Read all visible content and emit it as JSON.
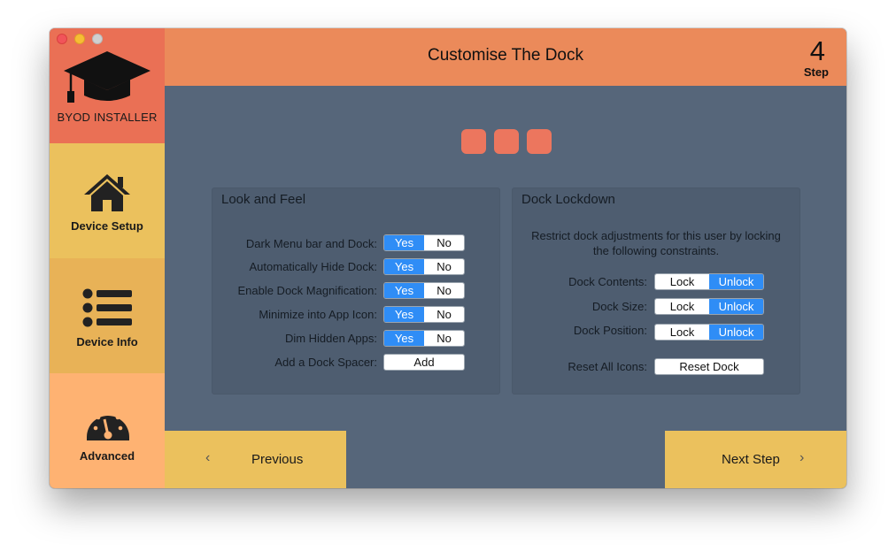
{
  "app": {
    "name": "BYOD INSTALLER"
  },
  "colors": {
    "logo_bg": "#ea7055",
    "header_bg": "#eb8a5a",
    "content_bg": "#56667a",
    "accent_blue": "#2f8df6",
    "nav_yellow": "#ebc15d"
  },
  "sidebar": {
    "items": [
      {
        "label": "Device Setup",
        "icon": "house-icon"
      },
      {
        "label": "Device Info",
        "icon": "list-icon"
      },
      {
        "label": "Advanced",
        "icon": "gauge-icon"
      }
    ]
  },
  "header": {
    "title": "Customise The Dock",
    "step_number": "4",
    "step_label": "Step"
  },
  "progress": {
    "dots": 3
  },
  "look_and_feel": {
    "title": "Look and Feel",
    "rows": [
      {
        "label": "Dark Menu bar and Dock:",
        "yes": "Yes",
        "no": "No",
        "selected": "Yes"
      },
      {
        "label": "Automatically Hide Dock:",
        "yes": "Yes",
        "no": "No",
        "selected": "Yes"
      },
      {
        "label": "Enable Dock Magnification:",
        "yes": "Yes",
        "no": "No",
        "selected": "Yes"
      },
      {
        "label": "Minimize into App Icon:",
        "yes": "Yes",
        "no": "No",
        "selected": "Yes"
      },
      {
        "label": "Dim Hidden Apps:",
        "yes": "Yes",
        "no": "No",
        "selected": "Yes"
      }
    ],
    "spacer": {
      "label": "Add a Dock Spacer:",
      "button": "Add"
    }
  },
  "dock_lockdown": {
    "title": "Dock Lockdown",
    "description": "Restrict dock adjustments for this user by locking the following constraints.",
    "rows": [
      {
        "label": "Dock Contents:",
        "lock": "Lock",
        "unlock": "Unlock",
        "selected": "Unlock"
      },
      {
        "label": "Dock Size:",
        "lock": "Lock",
        "unlock": "Unlock",
        "selected": "Unlock"
      },
      {
        "label": "Dock Position:",
        "lock": "Lock",
        "unlock": "Unlock",
        "selected": "Unlock"
      }
    ],
    "reset": {
      "label": "Reset All Icons:",
      "button": "Reset Dock"
    }
  },
  "footer": {
    "previous": "Previous",
    "next": "Next Step"
  }
}
